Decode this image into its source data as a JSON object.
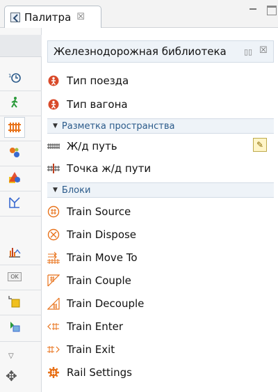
{
  "tab": {
    "title": "Палитра",
    "close": "☒"
  },
  "panel": {
    "title": "Железнодорожная библиотека",
    "menu": "▯▯",
    "close": "☒"
  },
  "items_top": [
    {
      "label": "Тип поезда"
    },
    {
      "label": "Тип вагона"
    }
  ],
  "sections": [
    {
      "label": "Разметка пространства",
      "items": [
        {
          "label": "Ж/д путь"
        },
        {
          "label": "Точка ж/д пути"
        }
      ]
    },
    {
      "label": "Блоки",
      "items": [
        {
          "label": "Train Source"
        },
        {
          "label": "Train Dispose"
        },
        {
          "label": "Train Move To"
        },
        {
          "label": "Train Couple"
        },
        {
          "label": "Train Decouple"
        },
        {
          "label": "Train Enter"
        },
        {
          "label": "Train Exit"
        },
        {
          "label": "Rail Settings"
        }
      ]
    }
  ],
  "strip": {
    "ok_label": "OK"
  },
  "colors": {
    "accent": "#e8721a",
    "agent_red": "#d94a2a",
    "section_bg": "#eef3f8",
    "section_text": "#2a5a8a"
  }
}
